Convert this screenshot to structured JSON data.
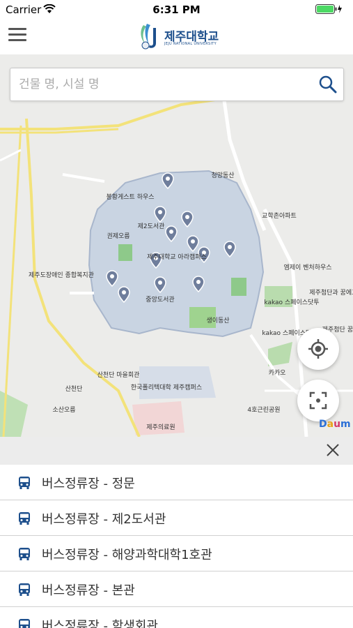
{
  "status_bar": {
    "carrier": "Carrier",
    "time": "6:31 PM"
  },
  "header": {
    "logo_name": "제주대학교",
    "logo_sub": "JEJU NATIONAL UNIVERSITY",
    "menu_icon": "hamburger-menu-icon"
  },
  "search": {
    "placeholder": "건물 명, 시설 명",
    "value": "",
    "icon": "search-icon"
  },
  "map": {
    "labels": [
      "제주도장애인 종합복지관",
      "봉황게스트 하우스",
      "제2도서관",
      "권제오름",
      "제주대학교 아라캠퍼스",
      "중앙도서관",
      "생이동산",
      "청망동산",
      "교학촌아파트",
      "엠제이 벤처하우스",
      "kakao 스페이스닷투",
      "kakao 스페이스닷원",
      "카카오",
      "4호근린공원",
      "산천단 마을회관",
      "산천단",
      "소산오름",
      "한국폴리텍대학 제주캠퍼스",
      "제주의료원",
      "제주첨단과 꿈에그린",
      "제주첨단 꿈에"
    ],
    "provider": "Daum",
    "locate_icon": "crosshair-icon",
    "focus_icon": "focus-frame-icon"
  },
  "list": {
    "close_icon": "close-icon",
    "items": [
      {
        "label": "버스정류장 - 정문",
        "icon": "bus-icon"
      },
      {
        "label": "버스정류장 - 제2도서관",
        "icon": "bus-icon"
      },
      {
        "label": "버스정류장 - 해양과학대학1호관",
        "icon": "bus-icon"
      },
      {
        "label": "버스정류장 - 본관",
        "icon": "bus-icon"
      },
      {
        "label": "버스정류장 - 학생회관",
        "icon": "bus-icon"
      }
    ]
  },
  "colors": {
    "accent": "#1d4f8c",
    "map_bg": "#ececea",
    "campus": "#c9d4e2",
    "pin": "#6f7e9c",
    "road": "#f3e27a"
  }
}
